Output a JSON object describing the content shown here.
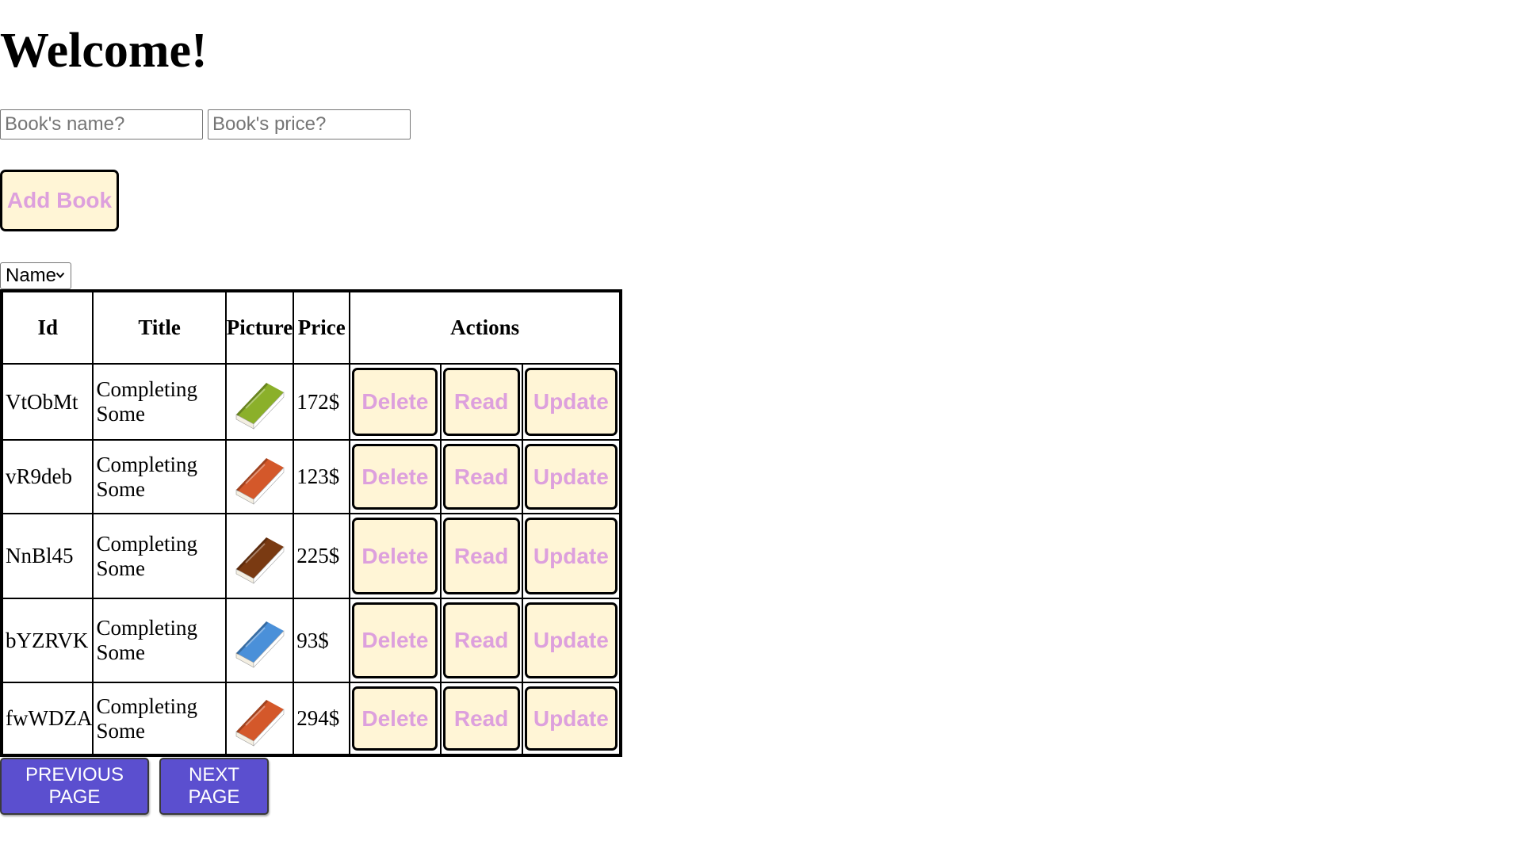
{
  "heading": "Welcome!",
  "form": {
    "name_placeholder": "Book's name?",
    "price_placeholder": "Book's price?",
    "add_label": "Add Book"
  },
  "sort": {
    "selected": "Name"
  },
  "table": {
    "columns": [
      "Id",
      "Title",
      "Picture",
      "Price",
      "Actions"
    ],
    "rows": [
      {
        "id": "VtObMt",
        "title": "Completing Some",
        "price": "172$",
        "cover": "green-book-icon"
      },
      {
        "id": "vR9deb",
        "title": "Completing Some",
        "price": "123$",
        "cover": "orange-book-icon"
      },
      {
        "id": "NnBl45",
        "title": "Completing Some",
        "price": "225$",
        "cover": "brown-book-icon"
      },
      {
        "id": "bYZRVK",
        "title": "Completing Some",
        "price": "93$",
        "cover": "blue-book-icon"
      },
      {
        "id": "fwWDZA",
        "title": "Completing Some",
        "price": "294$",
        "cover": "orange-book-icon"
      }
    ],
    "actions": {
      "delete": "Delete",
      "read": "Read",
      "update": "Update"
    }
  },
  "pagination": {
    "prev_label": "PREVIOUS PAGE",
    "next_label": "NEXT PAGE"
  },
  "colors": {
    "action_button_bg": "#fff5d6",
    "action_button_text": "#dda0dd",
    "nav_button_bg": "#5b4fcf",
    "green-book-icon": "#8bb02a",
    "orange-book-icon": "#d4582a",
    "brown-book-icon": "#7a3a12",
    "blue-book-icon": "#4a90d9"
  }
}
